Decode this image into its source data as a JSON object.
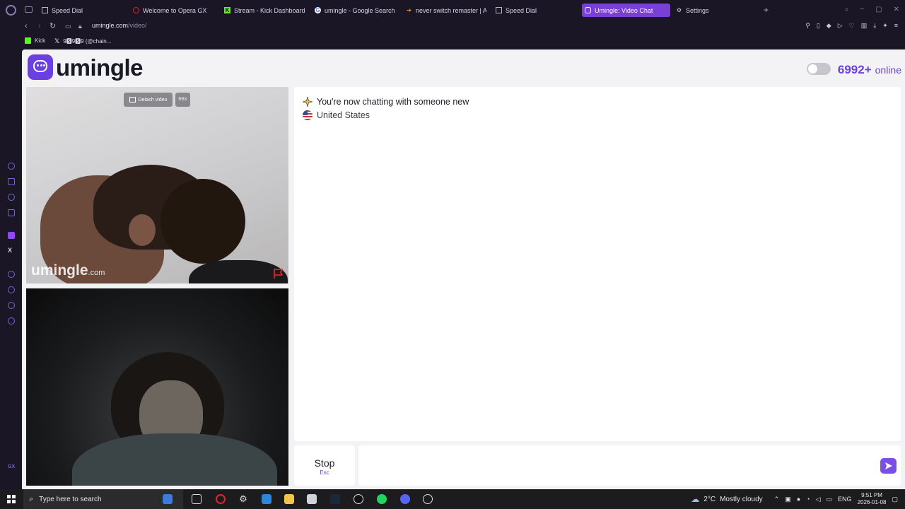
{
  "browser": {
    "tabs": [
      {
        "label": "Speed Dial",
        "icon": "speed-dial-icon"
      },
      {
        "label": "Welcome to Opera GX",
        "icon": "opera-icon"
      },
      {
        "label": "Stream - Kick Dashboard",
        "icon": "kick-icon"
      },
      {
        "label": "umingle - Google Search",
        "icon": "google-icon"
      },
      {
        "label": "never switch remaster | A",
        "icon": "video-icon"
      },
      {
        "label": "Speed Dial",
        "icon": "speed-dial-icon"
      },
      {
        "label": "Umingle: Video Chat",
        "icon": "umingle-icon"
      },
      {
        "label": "Settings",
        "icon": "gear-icon"
      }
    ],
    "active_tab_index": 6,
    "url_host": "umingle.com",
    "url_path": "/video/",
    "bookmarks": [
      {
        "label": "Kick",
        "icon": "kick-icon"
      },
      {
        "label": "9🆂9🆂9 (@chain...",
        "icon": "x-icon"
      }
    ],
    "sidebar_text_x": "X",
    "sidebar_text_gx": "GX"
  },
  "page": {
    "logo_text": "umingle",
    "online_count": "6992+",
    "online_label": "online",
    "remote_video": {
      "detach_label": "Detach video",
      "rbx_label": "RBX",
      "watermark": "umingle",
      "watermark_suffix": ".com"
    },
    "chat": {
      "status_message": "You're now chatting with someone new",
      "country": "United States"
    },
    "stop_button": {
      "label": "Stop",
      "shortcut": "Esc"
    },
    "message_input": {
      "value": "",
      "placeholder": ""
    },
    "colors": {
      "accent": "#6c3fe0",
      "report": "#e0202c"
    }
  },
  "taskbar": {
    "search_placeholder": "Type here to search",
    "weather_temp": "2°C",
    "weather_desc": "Mostly cloudy",
    "language": "ENG",
    "time": "9:51 PM",
    "date": "2026-01-08"
  }
}
